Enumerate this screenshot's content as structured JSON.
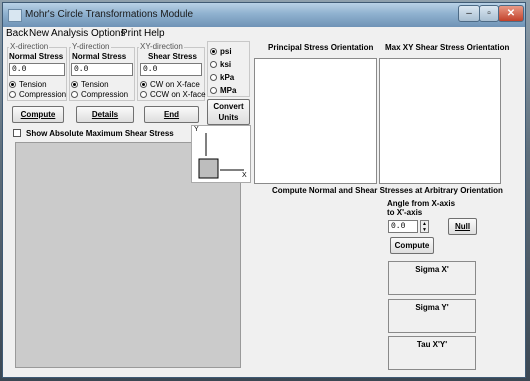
{
  "window": {
    "title": "Mohr's Circle Transformations Module"
  },
  "menu": [
    "Back",
    "New",
    "Analysis Options",
    "Print",
    "Help"
  ],
  "x_direction": {
    "group": "X-direction",
    "label": "Normal Stress",
    "value": "0.0",
    "opt1": "Tension",
    "opt2": "Compression"
  },
  "y_direction": {
    "group": "Y-direction",
    "label": "Normal Stress",
    "value": "0.0",
    "opt1": "Tension",
    "opt2": "Compression"
  },
  "xy_direction": {
    "group": "XY-direction",
    "label": "Shear Stress",
    "value": "0.0",
    "opt1": "CW on X-face",
    "opt2": "CCW on X-face"
  },
  "units": {
    "options": [
      "psi",
      "ksi",
      "kPa",
      "MPa"
    ],
    "selected": "psi",
    "convert": "Convert Units"
  },
  "buttons": {
    "compute": "Compute",
    "details": "Details",
    "end": "End"
  },
  "show_abs_max": "Show Absolute Maximum Shear Stress",
  "element_axes": {
    "y": "Y",
    "x": "X"
  },
  "principal_heading": "Principal Stress Orientation",
  "maxshear_heading": "Max XY Shear Stress Orientation",
  "arbitrary": {
    "heading": "Compute Normal and Shear Stresses at Arbitrary Orientation",
    "angle_label_1": "Angle from X-axis",
    "angle_label_2": "to X'-axis",
    "angle_value": "0.0",
    "null_button": "Null",
    "compute_button": "Compute",
    "outputs": [
      "Sigma X'",
      "Sigma Y'",
      "Tau X'Y'"
    ]
  }
}
